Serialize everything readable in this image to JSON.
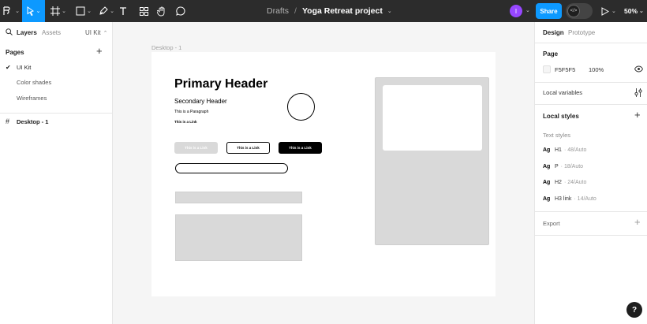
{
  "toolbar": {
    "breadcrumb_parent": "Drafts",
    "breadcrumb_separator": "/",
    "file_name": "Yoga Retreat project",
    "avatar_initial": "I",
    "share_label": "Share",
    "zoom_level": "50%",
    "icons": [
      "main-menu-icon",
      "move-tool-icon",
      "frame-tool-icon",
      "shape-tool-icon",
      "pen-tool-icon",
      "text-tool-icon",
      "components-icon",
      "hand-tool-icon",
      "comment-icon",
      "dev-mode-icon",
      "present-icon"
    ],
    "accent": "#0d99ff"
  },
  "left_panel": {
    "tabs": {
      "layers": "Layers",
      "assets": "Assets",
      "library": "UI Kit"
    },
    "pages_heading": "Pages",
    "pages": [
      {
        "label": "UI Kit",
        "selected": true
      },
      {
        "label": "Color shades",
        "selected": false
      },
      {
        "label": "Wireframes",
        "selected": false
      }
    ],
    "layers": [
      {
        "label": "Desktop - 1"
      }
    ]
  },
  "canvas": {
    "frame_label": "Desktop - 1",
    "primary_header": "Primary Header",
    "secondary_header": "Secondary Header",
    "paragraph": "This is a Paragraph",
    "link": "This is a Link",
    "buttons": [
      "This is a Link",
      "This is a Link",
      "This is a Link"
    ]
  },
  "right_panel": {
    "tabs": {
      "design": "Design",
      "prototype": "Prototype"
    },
    "page_heading": "Page",
    "page_color": "F5F5F5",
    "page_opacity": "100%",
    "local_variables": "Local variables",
    "local_styles": "Local styles",
    "text_styles_heading": "Text styles",
    "text_styles": [
      {
        "sample": "Ag",
        "name": "H1",
        "meta": "· 48/Auto"
      },
      {
        "sample": "Ag",
        "name": "P",
        "meta": "· 18/Auto"
      },
      {
        "sample": "Ag",
        "name": "H2",
        "meta": "· 24/Auto"
      },
      {
        "sample": "Ag",
        "name": "H3 link",
        "meta": "· 14/Auto"
      }
    ],
    "export": "Export"
  },
  "help_label": "?"
}
